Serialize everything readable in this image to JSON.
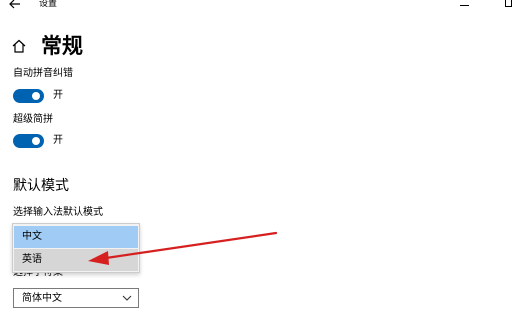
{
  "titlebar": {
    "title": "设置",
    "back_icon": "back-arrow-icon",
    "minimize_icon": "minimize-icon",
    "maximize_icon": "maximize-icon"
  },
  "header": {
    "icon": "home-icon",
    "title": "常规"
  },
  "settings": [
    {
      "label": "自动拼音纠错",
      "toggle_state": "开",
      "enabled": true
    },
    {
      "label": "超级简拼",
      "toggle_state": "开",
      "enabled": true
    }
  ],
  "section": {
    "title": "默认模式",
    "default_mode_label": "选择输入法默认模式",
    "default_mode_options": [
      "中文",
      "英语"
    ],
    "default_mode_selected": "中文",
    "charset_label_partial": "选择字符集",
    "charset_value": "简体中文"
  },
  "colors": {
    "accent": "#0063b1",
    "selected_option": "#9fcbf5",
    "hover_option": "#d6d6d6",
    "annotation_arrow": "#d62020"
  }
}
